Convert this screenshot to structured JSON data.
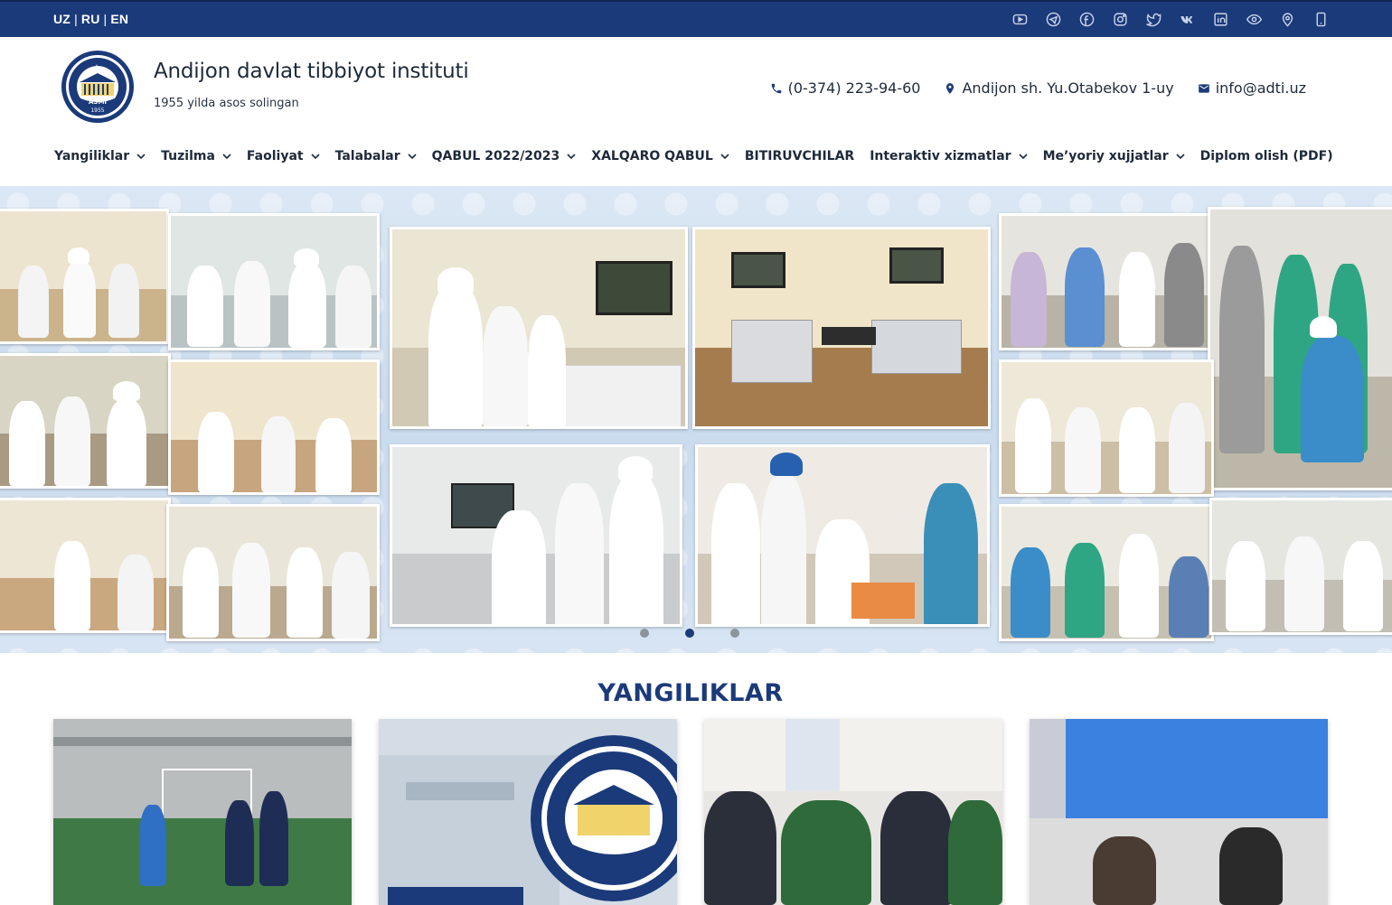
{
  "topbar": {
    "languages": [
      "UZ",
      "RU",
      "EN"
    ],
    "social_icons": [
      "youtube-icon",
      "telegram-icon",
      "facebook-icon",
      "instagram-icon",
      "twitter-icon",
      "vk-icon",
      "linkedin-icon",
      "eye-icon",
      "location-pin-icon",
      "mobile-icon"
    ],
    "colors": {
      "bar": "#1b3a7a"
    }
  },
  "header": {
    "title": "Andijon davlat tibbiyot instituti",
    "subtitle": "1955 yilda asos solingan",
    "logo_text": "ASMI",
    "logo_year": "1955",
    "phone": "(0-374) 223-94-60",
    "address": "Andijon sh. Yu.Otabekov 1-uy",
    "email": "info@adti.uz"
  },
  "nav": {
    "items": [
      {
        "label": "Yangiliklar",
        "dropdown": true
      },
      {
        "label": "Tuzilma",
        "dropdown": true
      },
      {
        "label": "Faoliyat",
        "dropdown": true
      },
      {
        "label": "Talabalar",
        "dropdown": true
      },
      {
        "label": "QABUL 2022/2023",
        "dropdown": true
      },
      {
        "label": "XALQARO QABUL",
        "dropdown": true
      },
      {
        "label": "BITIRUVCHILAR",
        "dropdown": false
      },
      {
        "label": "Interaktiv xizmatlar",
        "dropdown": true
      },
      {
        "label": "Me’yoriy xujjatlar",
        "dropdown": true
      },
      {
        "label": "Diplom olish (PDF)",
        "dropdown": false
      }
    ]
  },
  "slider": {
    "slide_count": 3,
    "active_index": 1
  },
  "news": {
    "heading": "YANGILIKLAR"
  },
  "colors": {
    "brand": "#1b3a7a",
    "text": "#1e2a3a"
  }
}
